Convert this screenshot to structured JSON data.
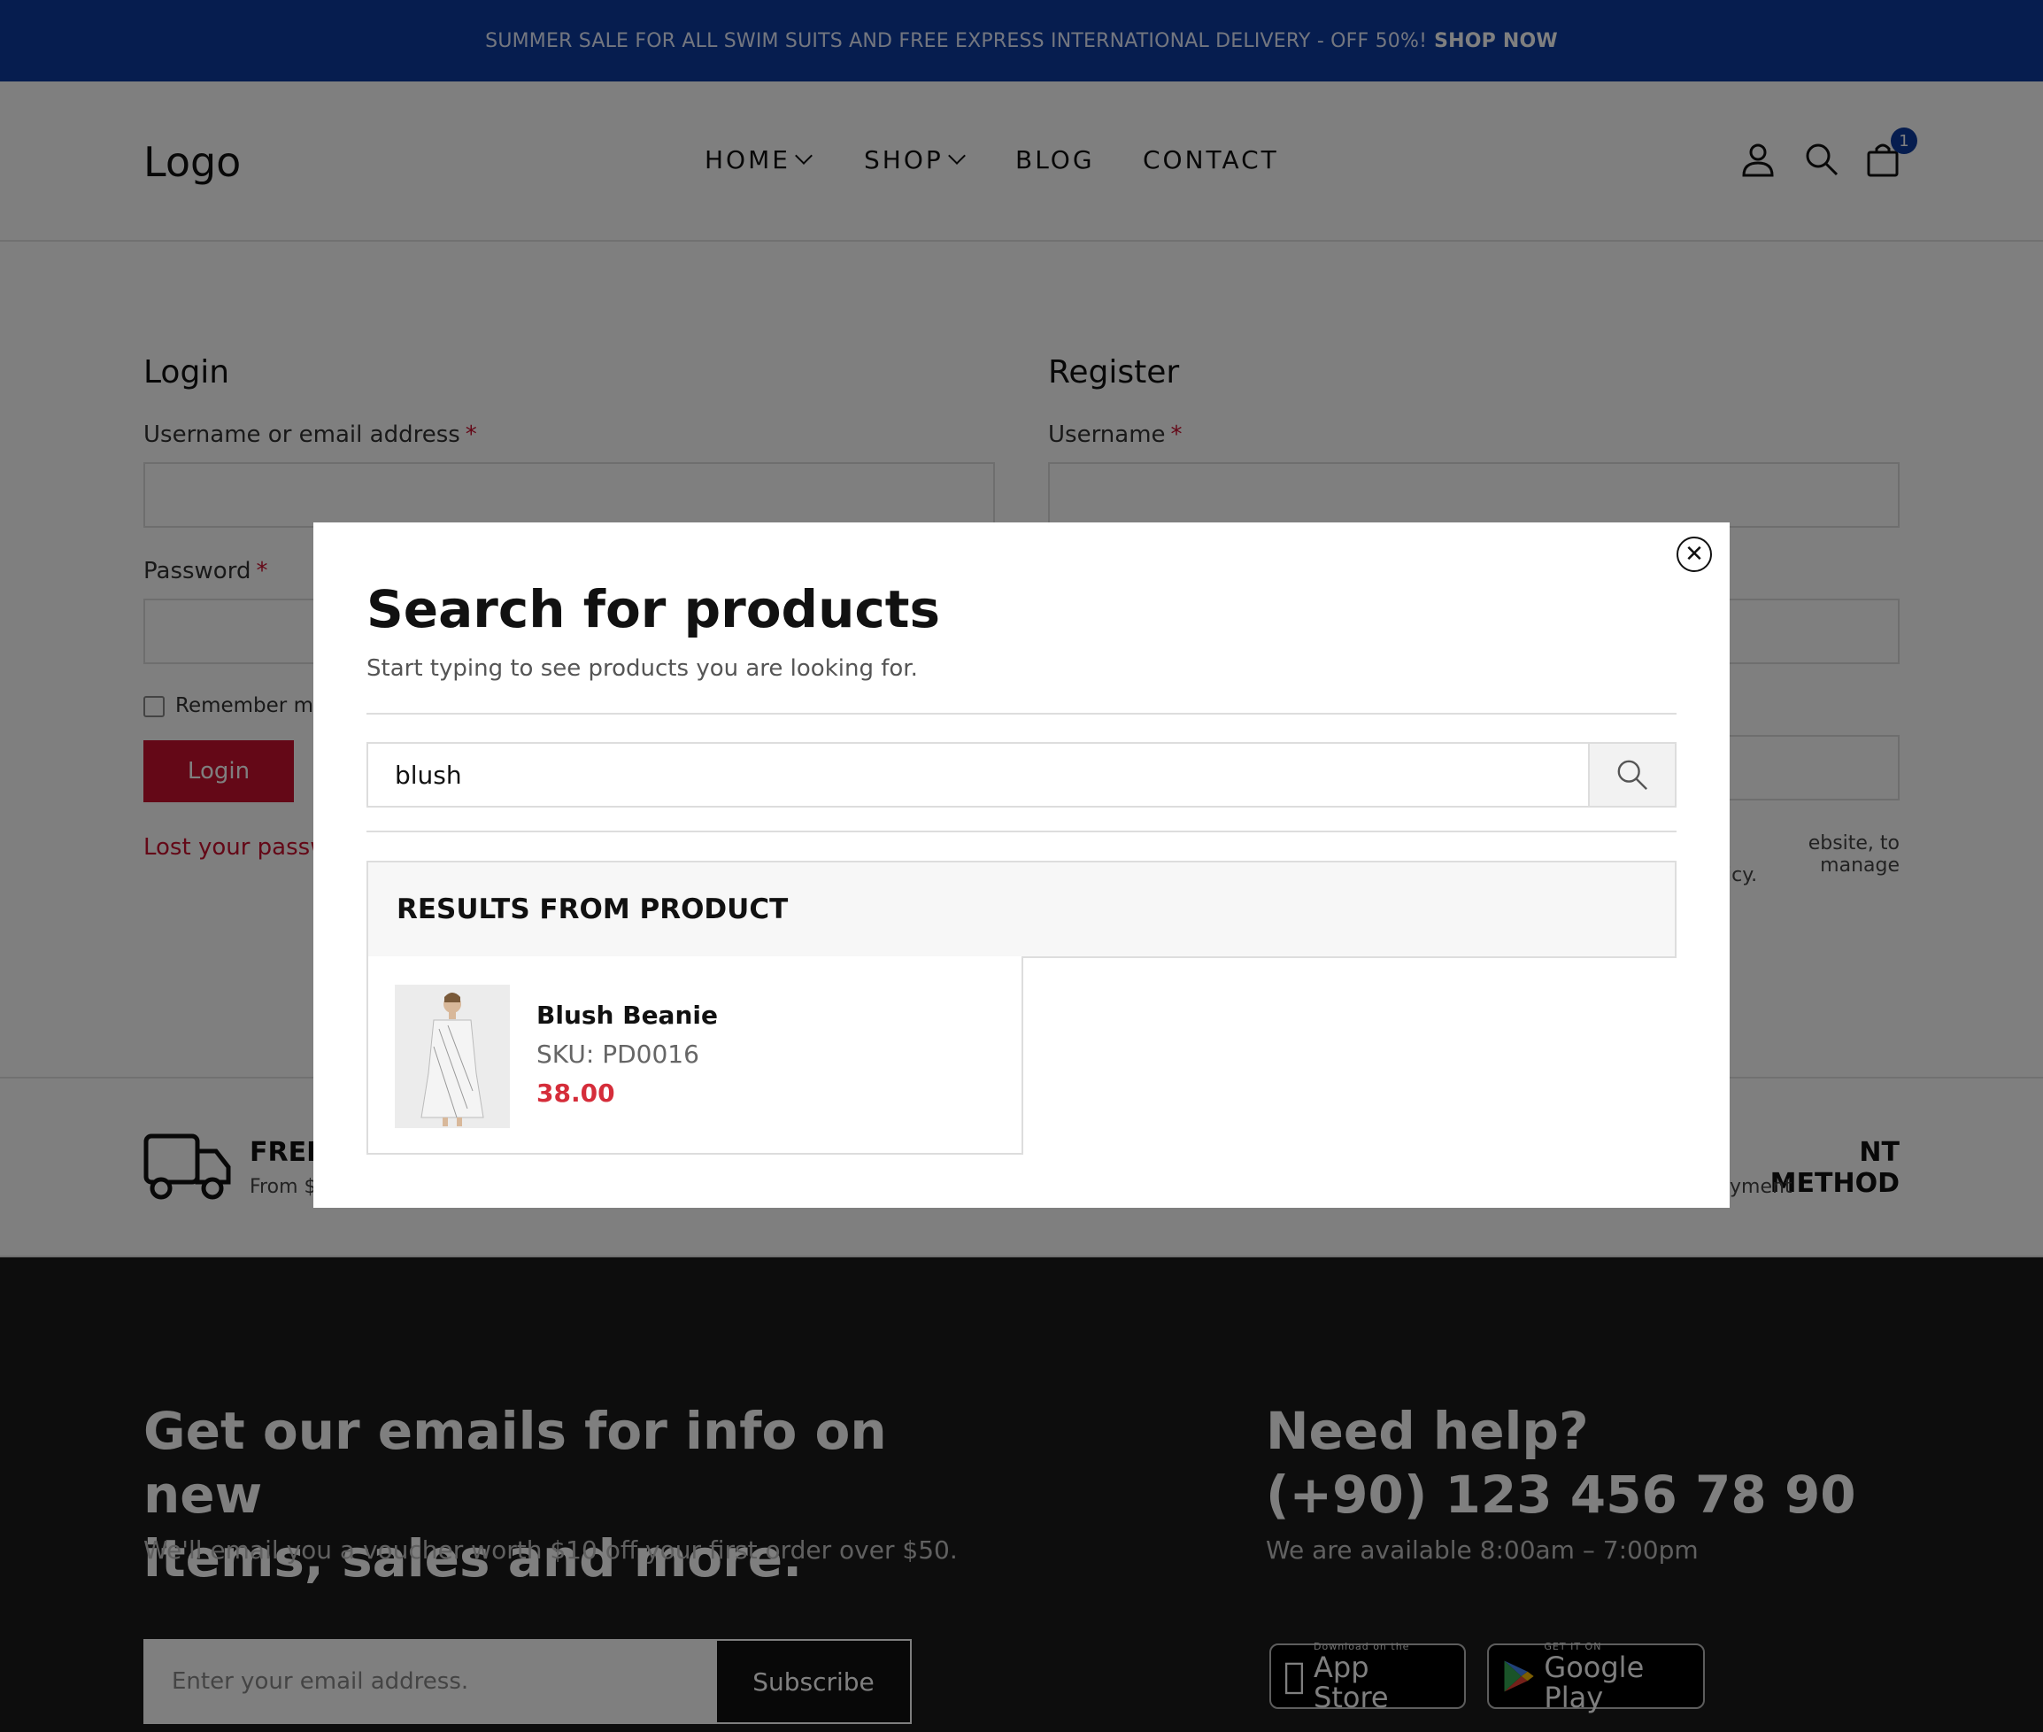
{
  "banner": {
    "text": "SUMMER SALE FOR ALL SWIM SUITS AND FREE EXPRESS INTERNATIONAL DELIVERY - OFF 50%!",
    "link": "SHOP NOW"
  },
  "header": {
    "logo": "Logo",
    "nav": [
      "HOME",
      "SHOP",
      "BLOG",
      "CONTACT"
    ],
    "cart_count": "1"
  },
  "login": {
    "title": "Login",
    "username_label": "Username or email address",
    "password_label": "Password",
    "required": "*",
    "remember": "Remember me",
    "button": "Login",
    "lost": "Lost your passw"
  },
  "register": {
    "title": "Register",
    "username_label": "Username",
    "required": "*",
    "privacy_1": "ebsite, to manage",
    "privacy_2": "icy."
  },
  "features": {
    "left_title": "FREE",
    "left_sub": "From $",
    "right_title": "NT METHOD",
    "right_sub": "yment"
  },
  "footer": {
    "news_title_1": "Get our emails for info on new",
    "news_title_2": "items, sales and more.",
    "news_sub": "We'll email you a voucher worth $10 off your first order over $50.",
    "email_placeholder": "Enter your email address.",
    "subscribe": "Subscribe",
    "help_title": "Need help?",
    "phone": "(+90) 123 456 78 90",
    "hours": "We are available 8:00am – 7:00pm",
    "app_store_small": "Download on the",
    "app_store": "App Store",
    "google_small": "GET IT ON",
    "google_play": "Google Play"
  },
  "modal": {
    "title": "Search for products",
    "subtitle": "Start typing to see products you are looking for.",
    "query": "blush",
    "results_heading": "RESULTS FROM PRODUCT",
    "results": [
      {
        "name": "Blush Beanie",
        "sku": "SKU: PD0016",
        "price": "38.00"
      }
    ]
  },
  "colors": {
    "brand_blue": "#0d3b9e",
    "accent_red": "#c8102e",
    "price_red": "#d52d3a"
  }
}
